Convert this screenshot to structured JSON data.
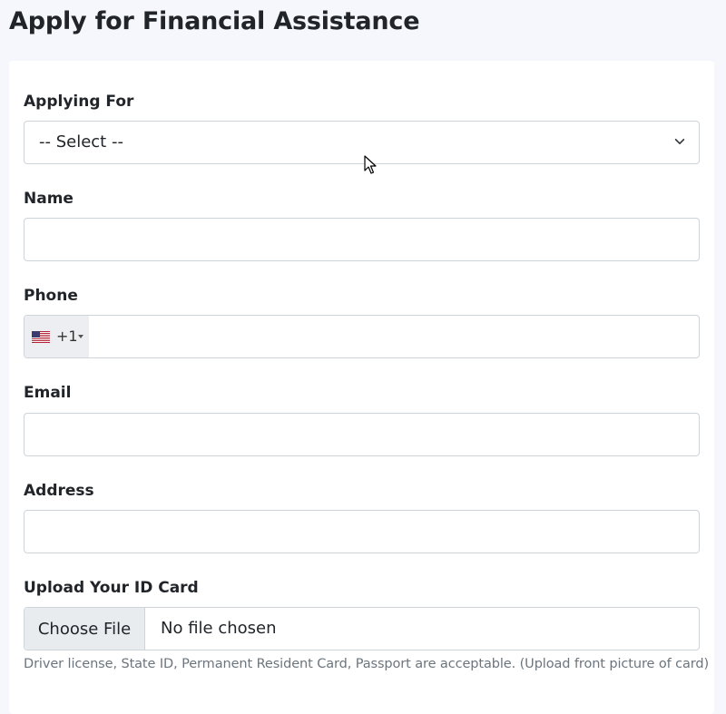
{
  "page": {
    "title": "Apply for Financial Assistance"
  },
  "form": {
    "applying_for": {
      "label": "Applying For",
      "selected": "-- Select --"
    },
    "name": {
      "label": "Name",
      "value": ""
    },
    "phone": {
      "label": "Phone",
      "country_flag": "us-flag-icon",
      "dial_code": "+1",
      "value": ""
    },
    "email": {
      "label": "Email",
      "value": ""
    },
    "address": {
      "label": "Address",
      "value": ""
    },
    "id_card": {
      "label": "Upload Your ID Card",
      "button_label": "Choose File",
      "status": "No file chosen",
      "help": "Driver license, State ID, Permanent Resident Card, Passport are acceptable. (Upload front picture of card)"
    }
  },
  "colors": {
    "background": "#f5f7fc",
    "card": "#ffffff",
    "border": "#ced4da",
    "muted_text": "#6c757d",
    "addon_bg": "#e9ecef"
  }
}
